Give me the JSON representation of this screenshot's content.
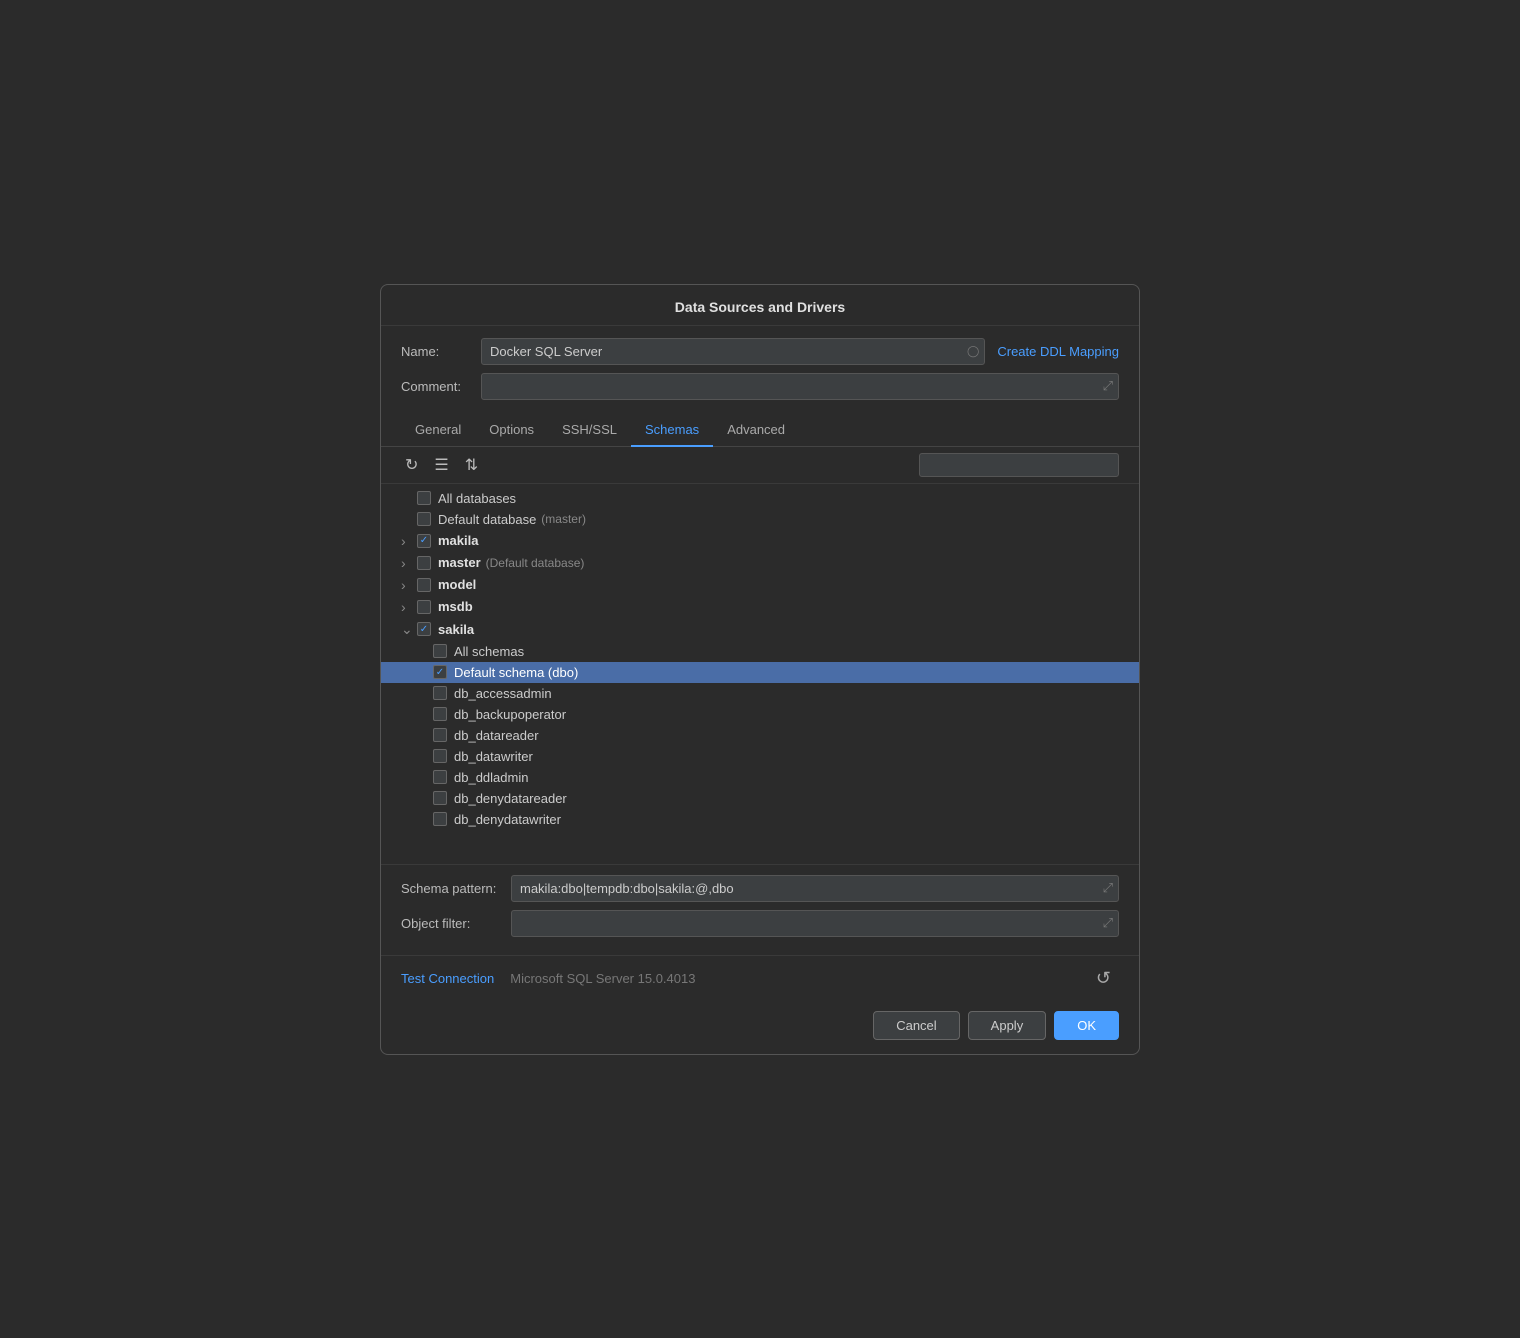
{
  "dialog": {
    "title": "Data Sources and Drivers",
    "name_label": "Name:",
    "name_value": "Docker SQL Server",
    "comment_label": "Comment:",
    "create_ddl_label": "Create DDL Mapping",
    "tabs": [
      {
        "label": "General",
        "active": false
      },
      {
        "label": "Options",
        "active": false
      },
      {
        "label": "SSH/SSL",
        "active": false
      },
      {
        "label": "Schemas",
        "active": true
      },
      {
        "label": "Advanced",
        "active": false
      }
    ],
    "search_placeholder": "",
    "tree_items": [
      {
        "indent": 0,
        "expander": "",
        "checked": false,
        "label": "All databases",
        "sub": "",
        "bold": false,
        "selected": false
      },
      {
        "indent": 0,
        "expander": "",
        "checked": false,
        "label": "Default database",
        "sub": "(master)",
        "bold": false,
        "selected": false
      },
      {
        "indent": 0,
        "expander": ">",
        "checked": true,
        "label": "makila",
        "sub": "",
        "bold": true,
        "selected": false
      },
      {
        "indent": 0,
        "expander": ">",
        "checked": false,
        "label": "master",
        "sub": "(Default database)",
        "bold": true,
        "selected": false
      },
      {
        "indent": 0,
        "expander": ">",
        "checked": false,
        "label": "model",
        "sub": "",
        "bold": true,
        "selected": false
      },
      {
        "indent": 0,
        "expander": ">",
        "checked": false,
        "label": "msdb",
        "sub": "",
        "bold": true,
        "selected": false
      },
      {
        "indent": 0,
        "expander": "v",
        "checked": true,
        "label": "sakila",
        "sub": "",
        "bold": true,
        "selected": false
      },
      {
        "indent": 1,
        "expander": "",
        "checked": false,
        "label": "All schemas",
        "sub": "",
        "bold": false,
        "selected": false
      },
      {
        "indent": 1,
        "expander": "",
        "checked": true,
        "label": "Default schema (dbo)",
        "sub": "",
        "bold": false,
        "selected": true
      },
      {
        "indent": 1,
        "expander": "",
        "checked": false,
        "label": "db_accessadmin",
        "sub": "",
        "bold": false,
        "selected": false
      },
      {
        "indent": 1,
        "expander": "",
        "checked": false,
        "label": "db_backupoperator",
        "sub": "",
        "bold": false,
        "selected": false
      },
      {
        "indent": 1,
        "expander": "",
        "checked": false,
        "label": "db_datareader",
        "sub": "",
        "bold": false,
        "selected": false
      },
      {
        "indent": 1,
        "expander": "",
        "checked": false,
        "label": "db_datawriter",
        "sub": "",
        "bold": false,
        "selected": false
      },
      {
        "indent": 1,
        "expander": "",
        "checked": false,
        "label": "db_ddladmin",
        "sub": "",
        "bold": false,
        "selected": false
      },
      {
        "indent": 1,
        "expander": "",
        "checked": false,
        "label": "db_denydatareader",
        "sub": "",
        "bold": false,
        "selected": false
      },
      {
        "indent": 1,
        "expander": "",
        "checked": false,
        "label": "db_denydatawriter",
        "sub": "",
        "bold": false,
        "selected": false
      }
    ],
    "schema_pattern_label": "Schema pattern:",
    "schema_pattern_value": "makila:dbo|tempdb:dbo|sakila:@,dbo",
    "object_filter_label": "Object filter:",
    "object_filter_value": "",
    "test_connection_label": "Test Connection",
    "server_info": "Microsoft SQL Server 15.0.4013",
    "cancel_label": "Cancel",
    "apply_label": "Apply",
    "ok_label": "OK"
  }
}
